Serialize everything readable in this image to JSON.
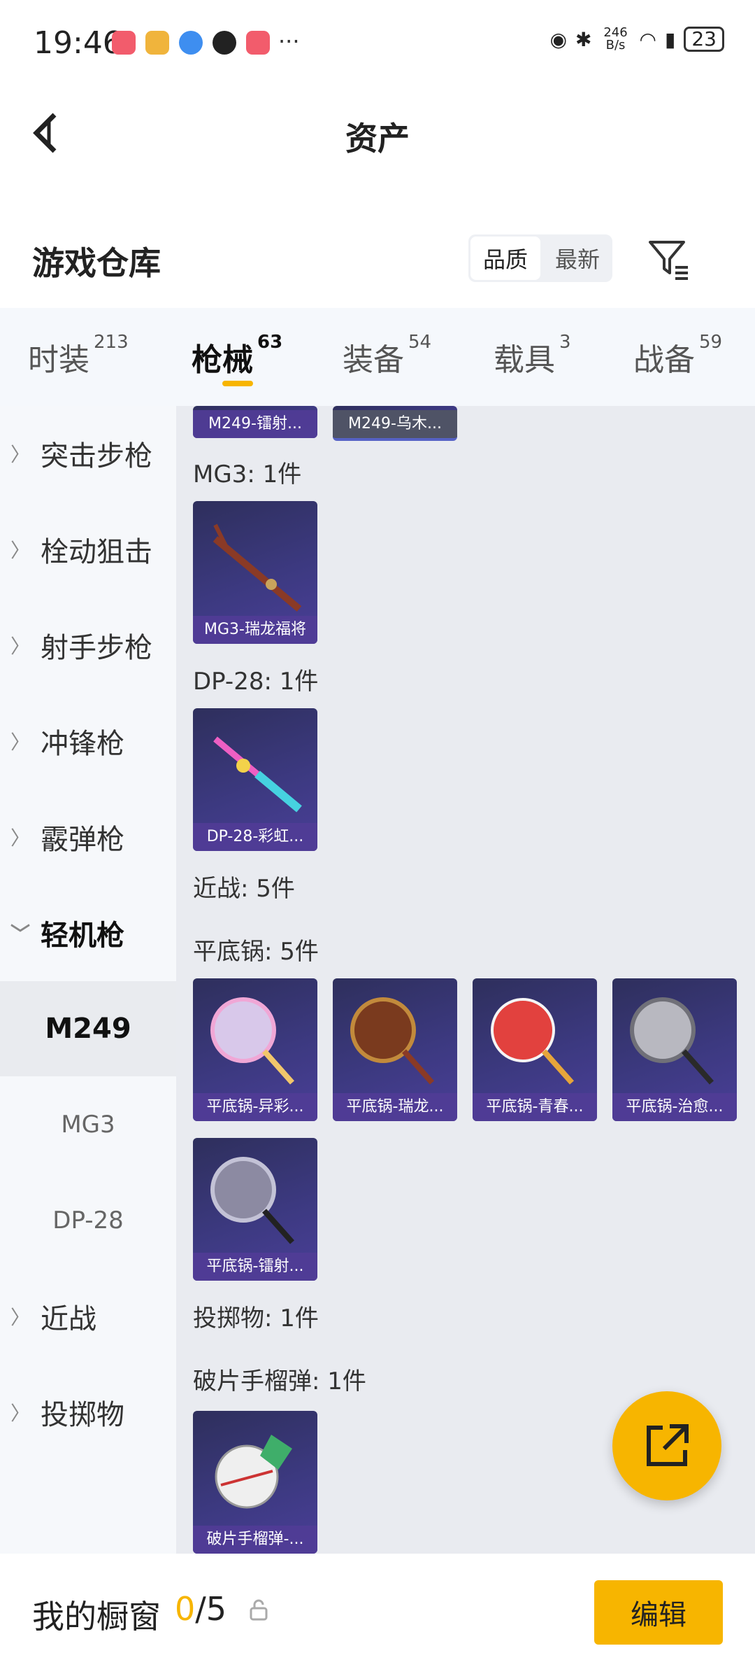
{
  "status_bar": {
    "time": "19:46",
    "net_speed": "246 B/s",
    "battery": "23"
  },
  "nav": {
    "title": "资产"
  },
  "warehouse": {
    "title": "游戏仓库",
    "sort_options": [
      "品质",
      "最新"
    ]
  },
  "tabs": [
    {
      "label": "时装",
      "count": "213"
    },
    {
      "label": "枪械",
      "count": "63"
    },
    {
      "label": "装备",
      "count": "54"
    },
    {
      "label": "载具",
      "count": "3"
    },
    {
      "label": "战备",
      "count": "59"
    }
  ],
  "sidebar": {
    "items": [
      "突击步枪",
      "栓动狙击",
      "射手步枪",
      "冲锋枪",
      "霰弹枪",
      "轻机枪"
    ],
    "subitems": [
      "M249",
      "MG3",
      "DP-28"
    ],
    "items_after": [
      "近战",
      "投掷物"
    ]
  },
  "content": {
    "top_partial": [
      "M249-镭射...",
      "M249-乌木..."
    ],
    "groups": [
      {
        "label": "MG3: 1件",
        "items": [
          "MG3-瑞龙福将"
        ]
      },
      {
        "label": "DP-28: 1件",
        "items": [
          "DP-28-彩虹..."
        ]
      },
      {
        "label": "近战: 5件"
      },
      {
        "label": "平底锅: 5件",
        "items": [
          "平底锅-异彩...",
          "平底锅-瑞龙...",
          "平底锅-青春...",
          "平底锅-治愈...",
          "平底锅-镭射..."
        ]
      },
      {
        "label": "投掷物: 1件"
      },
      {
        "label": "破片手榴弹: 1件",
        "items": [
          "破片手榴弹-..."
        ]
      }
    ]
  },
  "bottom_bar": {
    "label": "我的橱窗",
    "count_current": "0",
    "count_total": "/5",
    "edit_label": "编辑"
  },
  "colors": {
    "accent": "#f7b500",
    "card_bg": "#3c3980"
  }
}
